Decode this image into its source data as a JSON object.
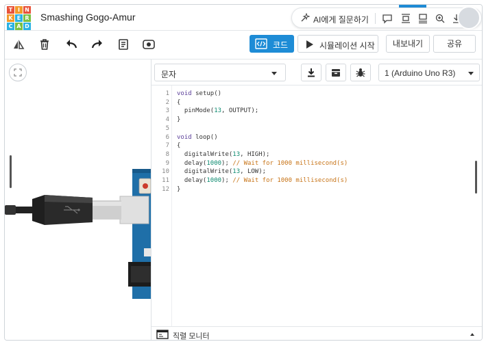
{
  "header": {
    "logo_letters": [
      "T",
      "I",
      "N",
      "K",
      "E",
      "R",
      "C",
      "A",
      "D"
    ],
    "project_title": "Smashing Gogo-Amur",
    "ai_label": "AI에게 질문하기",
    "icons": [
      "ai-sparkle-icon",
      "comment-icon",
      "fit-view-icon",
      "align-icon",
      "zoom-icon",
      "download-icon",
      "more-icon"
    ],
    "more_label": "···"
  },
  "toolbar": {
    "icons": [
      "rotate-icon",
      "trash-icon",
      "undo-icon",
      "redo-icon",
      "notes-icon",
      "visibility-icon"
    ],
    "code_label": "코드",
    "simulate_label": "시뮬레이션 시작",
    "export_label": "내보내기",
    "share_label": "공유",
    "accent": "#1e8cd6"
  },
  "code_panel": {
    "mode_select": "문자",
    "board_select": "1 (Arduino Uno R3)",
    "buttons": [
      "download-code-icon",
      "library-icon",
      "debug-icon"
    ],
    "line_numbers": [
      "1",
      "2",
      "3",
      "4",
      "5",
      "6",
      "7",
      "8",
      "9",
      "10",
      "11",
      "12"
    ],
    "code": {
      "l1_kw": "void",
      "l1_rest": " setup()",
      "l2": "{",
      "l3_a": "  pinMode(",
      "l3_num": "13",
      "l3_b": ", OUTPUT);",
      "l4": "}",
      "l6_kw": "void",
      "l6_rest": " loop()",
      "l7": "{",
      "l8_a": "  digitalWrite(",
      "l8_num": "13",
      "l8_b": ", HIGH);",
      "l9_a": "  delay(",
      "l9_num": "1000",
      "l9_b": "); ",
      "l9_cm": "// Wait for 1000 millisecond(s)",
      "l10_a": "  digitalWrite(",
      "l10_num": "13",
      "l10_b": ", LOW);",
      "l11_a": "  delay(",
      "l11_num": "1000",
      "l11_b": "); ",
      "l11_cm": "// Wait for 1000 millisecond(s)",
      "l12": "}"
    },
    "serial_monitor_label": "직렬 모니터"
  }
}
